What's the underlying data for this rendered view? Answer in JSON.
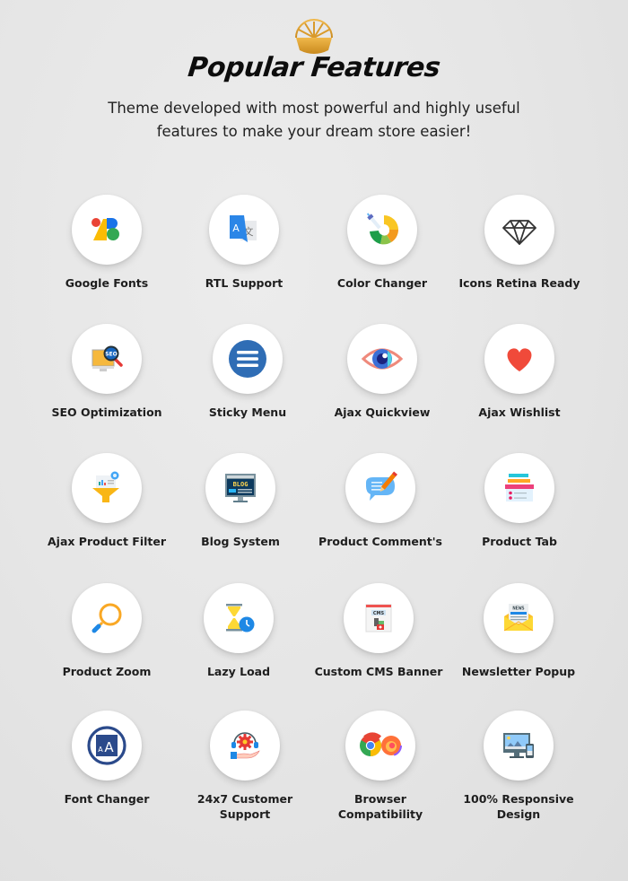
{
  "header": {
    "logo_icon": "golden-sunburst-logo",
    "title": "Popular Features",
    "subtitle_line1": "Theme developed with most powerful and highly useful",
    "subtitle_line2": "features to make your dream store easier!"
  },
  "features": [
    {
      "label": "Google Fonts",
      "icon": "google-fonts-icon"
    },
    {
      "label": "RTL Support",
      "icon": "translate-icon"
    },
    {
      "label": "Color Changer",
      "icon": "color-picker-icon"
    },
    {
      "label": "Icons Retina Ready",
      "icon": "diamond-icon"
    },
    {
      "label": "SEO Optimization",
      "icon": "seo-monitor-icon"
    },
    {
      "label": "Sticky Menu",
      "icon": "hamburger-menu-icon"
    },
    {
      "label": "Ajax Quickview",
      "icon": "eye-icon"
    },
    {
      "label": "Ajax Wishlist",
      "icon": "heart-icon"
    },
    {
      "label": "Ajax Product Filter",
      "icon": "funnel-filter-icon"
    },
    {
      "label": "Blog System",
      "icon": "blog-monitor-icon"
    },
    {
      "label": "Product Comment's",
      "icon": "comment-pencil-icon"
    },
    {
      "label": "Product Tab",
      "icon": "tabs-icon"
    },
    {
      "label": "Product Zoom",
      "icon": "magnifier-icon"
    },
    {
      "label": "Lazy Load",
      "icon": "hourglass-clock-icon"
    },
    {
      "label": "Custom CMS Banner",
      "icon": "cms-banner-icon"
    },
    {
      "label": "Newsletter Popup",
      "icon": "newsletter-envelope-icon"
    },
    {
      "label": "Font Changer",
      "icon": "font-size-icon"
    },
    {
      "label": "24x7 Customer",
      "label2": "Support",
      "icon": "support-headset-icon"
    },
    {
      "label": "Browser",
      "label2": "Compatibility",
      "icon": "browsers-icon"
    },
    {
      "label": "100% Responsive",
      "label2": "Design",
      "icon": "responsive-devices-icon"
    }
  ],
  "icon_texts": {
    "seo": "SEO",
    "blog": "BLOG",
    "cms": "CMS",
    "news": "NEWS",
    "font_small": "A",
    "font_big": "A",
    "rtl": "A"
  }
}
